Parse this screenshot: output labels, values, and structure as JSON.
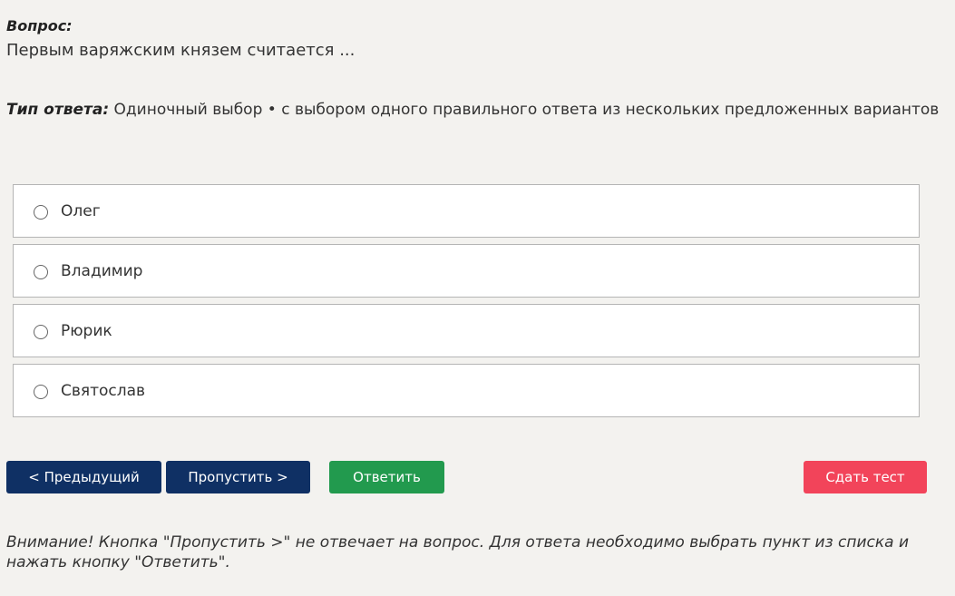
{
  "question": {
    "label": "Вопрос:",
    "text": "Первым варяжским князем считается ..."
  },
  "answer_type": {
    "label": "Тип ответа:",
    "value": " Одиночный выбор • с выбором одного правильного ответа из нескольких предложенных вариантов"
  },
  "options": [
    {
      "label": "Олег",
      "selected": false
    },
    {
      "label": "Владимир",
      "selected": false
    },
    {
      "label": "Рюрик",
      "selected": false
    },
    {
      "label": "Святослав",
      "selected": false
    }
  ],
  "buttons": {
    "prev": "< Предыдущий",
    "skip": "Пропустить >",
    "answer": "Ответить",
    "finish": "Сдать тест"
  },
  "colors": {
    "nav_button": "#0f3064",
    "answer_button": "#229a4e",
    "finish_button": "#f2445a",
    "background": "#f3f2ef"
  },
  "notice": "Внимание! Кнопка \"Пропустить >\" не отвечает на вопрос. Для ответа необходимо выбрать пункт из списка и нажать кнопку \"Ответить\"."
}
